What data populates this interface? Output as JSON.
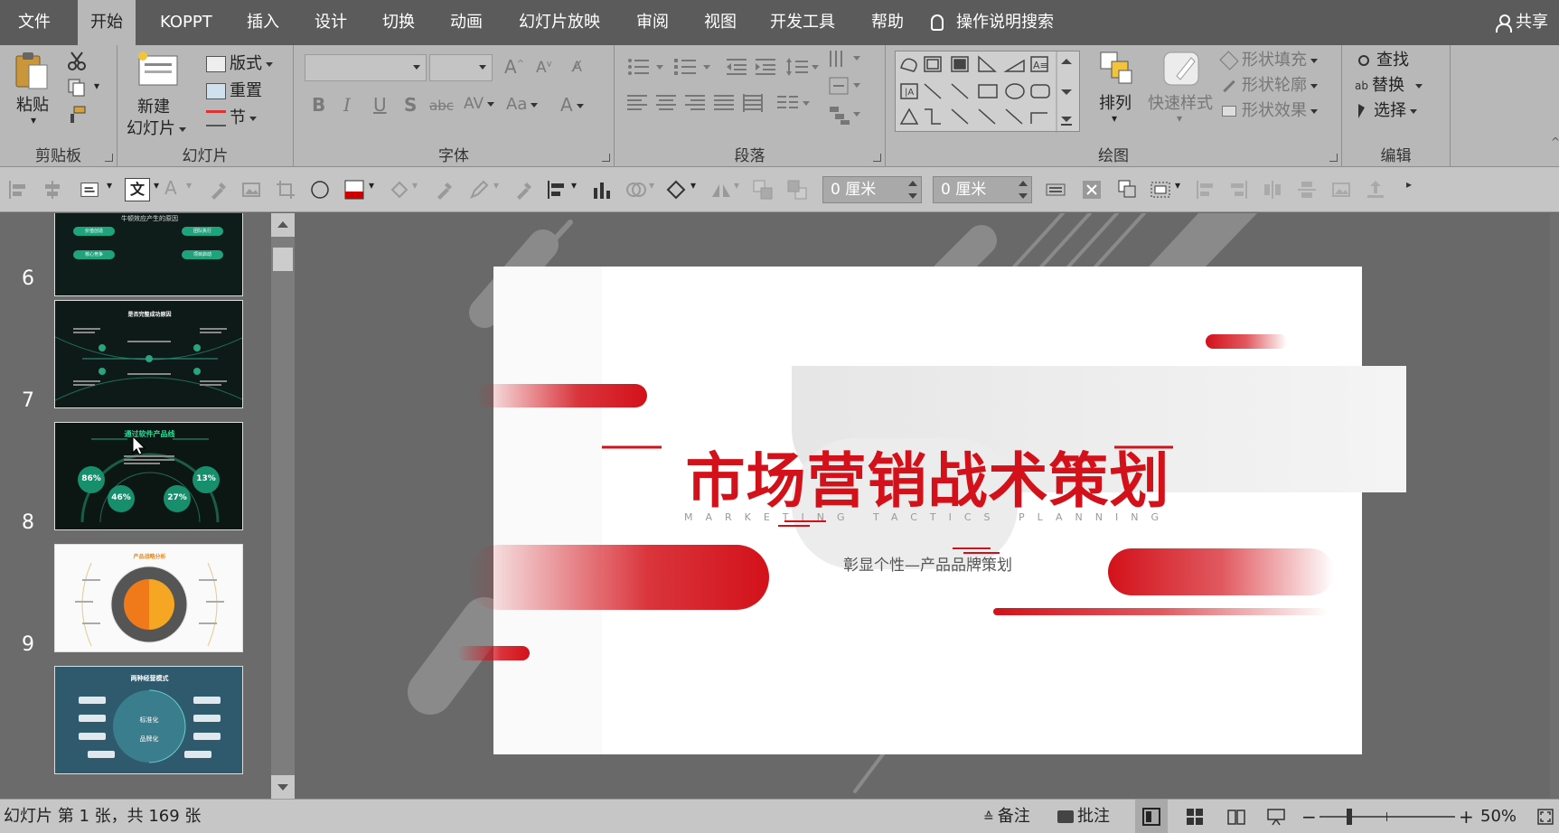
{
  "menu": {
    "items": [
      "文件",
      "开始",
      "KOPPT",
      "插入",
      "设计",
      "切换",
      "动画",
      "幻灯片放映",
      "审阅",
      "视图",
      "开发工具",
      "帮助"
    ],
    "active_index": 1,
    "tell_me": "操作说明搜索",
    "share": "共享"
  },
  "ribbon": {
    "clipboard": {
      "label": "剪贴板",
      "paste": "粘贴"
    },
    "slides": {
      "label": "幻灯片",
      "new_slide_line1": "新建",
      "new_slide_line2": "幻灯片",
      "layout": "版式",
      "reset": "重置",
      "section": "节"
    },
    "font": {
      "label": "字体",
      "bold": "B",
      "italic": "I",
      "underline": "U",
      "shadow": "S",
      "strike": "abc",
      "spacing": "AV",
      "case": "Aa",
      "grow": "A",
      "shrink": "A",
      "color": "A"
    },
    "paragraph": {
      "label": "段落"
    },
    "drawing": {
      "label": "绘图",
      "arrange": "排列",
      "quick_styles": "快速样式",
      "shape_fill": "形状填充",
      "shape_outline": "形状轮廓",
      "shape_effects": "形状效果"
    },
    "editing": {
      "label": "编辑",
      "find": "查找",
      "replace": "替换",
      "select": "选择"
    }
  },
  "toolbar2": {
    "width_value": "0 厘米",
    "height_value": "0 厘米",
    "text_glyph": "文"
  },
  "thumbnails": {
    "items": [
      {
        "number": "6",
        "title": "是否完整成功原因",
        "theme": "dark"
      },
      {
        "number": "7",
        "title": "通过软件产品线",
        "theme": "dark",
        "stats": [
          "86%",
          "46%",
          "27%",
          "13%"
        ]
      },
      {
        "number": "8",
        "title": "产品战略分析",
        "theme": "light"
      },
      {
        "number": "9",
        "title": "两种经营模式",
        "theme": "blue",
        "center_lines": [
          "标准化",
          "品牌化"
        ]
      }
    ],
    "top_partial": {
      "title": "牛顿效应产生的原因",
      "pills": [
        "价值创造",
        "团队执行",
        "核心竞争",
        "项目启动"
      ]
    }
  },
  "slide": {
    "title": "市场营销战术策划",
    "subtitle_en": "MARKETING TACTICS PLANNING",
    "subtitle_cn": "彰显个性—产品品牌策划",
    "accent": "#d3111a"
  },
  "status": {
    "slide_info": "幻灯片 第 1 张，共 169 张",
    "notes": "备注",
    "comments": "批注",
    "zoom": "50%"
  }
}
